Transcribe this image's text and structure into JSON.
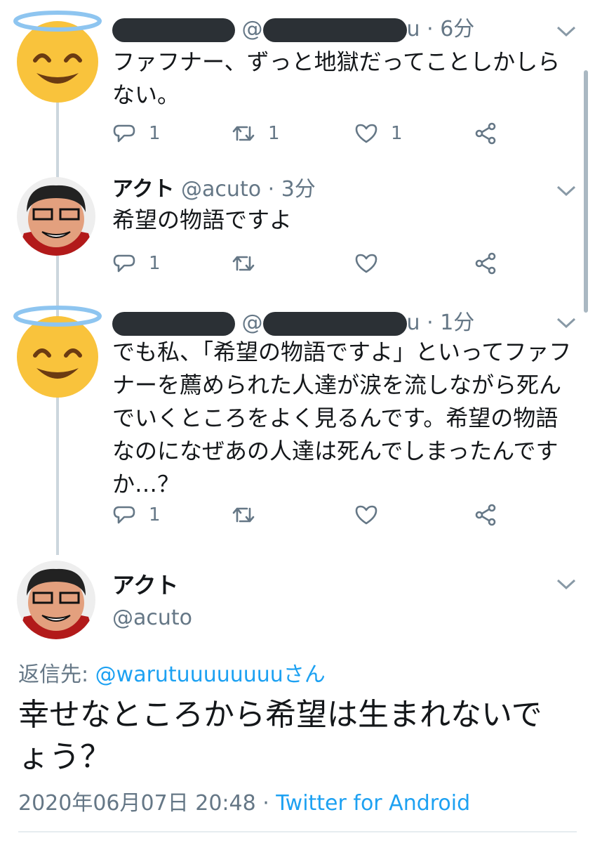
{
  "tweets": [
    {
      "name": "",
      "handle_start": "@",
      "handle_end": "u",
      "time": "6分",
      "text": "ファフナー、ずっと地獄だってことしかしらない。",
      "replies": "1",
      "retweets": "1",
      "likes": "1"
    },
    {
      "name": "アクト",
      "handle": "@acuto",
      "time": "3分",
      "text": "希望の物語ですよ",
      "replies": "1",
      "retweets": "",
      "likes": ""
    },
    {
      "name": "",
      "handle_start": "@",
      "handle_end": "u",
      "time": "1分",
      "text": "でも私、「希望の物語ですよ」といってファフナーを薦められた人達が涙を流しながら死んでいくところをよく見るんです。希望の物語なのになぜあの人達は死んでしまったんですか…？",
      "replies": "1",
      "retweets": "",
      "likes": ""
    }
  ],
  "detail": {
    "name": "アクト",
    "handle": "@acuto",
    "reply_label": "返信先: ",
    "reply_target": "@warutuuuuuuuuさん",
    "text": "幸せなところから希望は生まれないでょう？",
    "timestamp": "2020年06月07日 20:48 · ",
    "source": "Twitter for Android"
  },
  "colors": {
    "text": "#14171a",
    "secondary": "#657786",
    "link": "#1da1f2",
    "emoji_face": "#f9c33c",
    "halo": "#8ec5f0"
  }
}
